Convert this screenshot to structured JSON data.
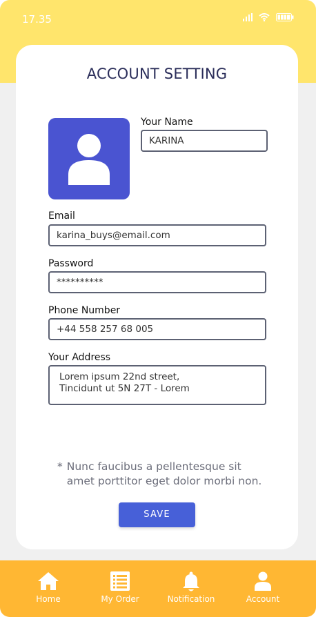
{
  "status_bar": {
    "time": "17.35"
  },
  "page": {
    "title": "ACCOUNT SETTING"
  },
  "form": {
    "name_label": "Your Name",
    "name_value": "KARINA",
    "email_label": "Email",
    "email_value": "karina_buys@email.com",
    "password_label": "Password",
    "password_value": "**********",
    "phone_label": "Phone Number",
    "phone_value": "+44 558 257 68 005",
    "address_label": "Your Address",
    "address_line1": "Lorem ipsum 22nd street,",
    "address_line2": "Tincidunt ut 5N 27T - Lorem"
  },
  "note": {
    "marker": "*",
    "text": "Nunc faucibus a pellentesque sit amet porttitor eget dolor morbi non."
  },
  "actions": {
    "save_label": "SAVE"
  },
  "nav": {
    "items": [
      {
        "label": "Home",
        "icon": "home-icon"
      },
      {
        "label": "My Order",
        "icon": "list-icon"
      },
      {
        "label": "Notification",
        "icon": "bell-icon"
      },
      {
        "label": "Account",
        "icon": "user-icon"
      }
    ]
  },
  "colors": {
    "header_yellow": "#ffe56c",
    "accent_blue": "#4a54d1",
    "save_blue": "#4760d8",
    "nav_orange": "#ffb733",
    "title_text": "#2b2e5a"
  }
}
